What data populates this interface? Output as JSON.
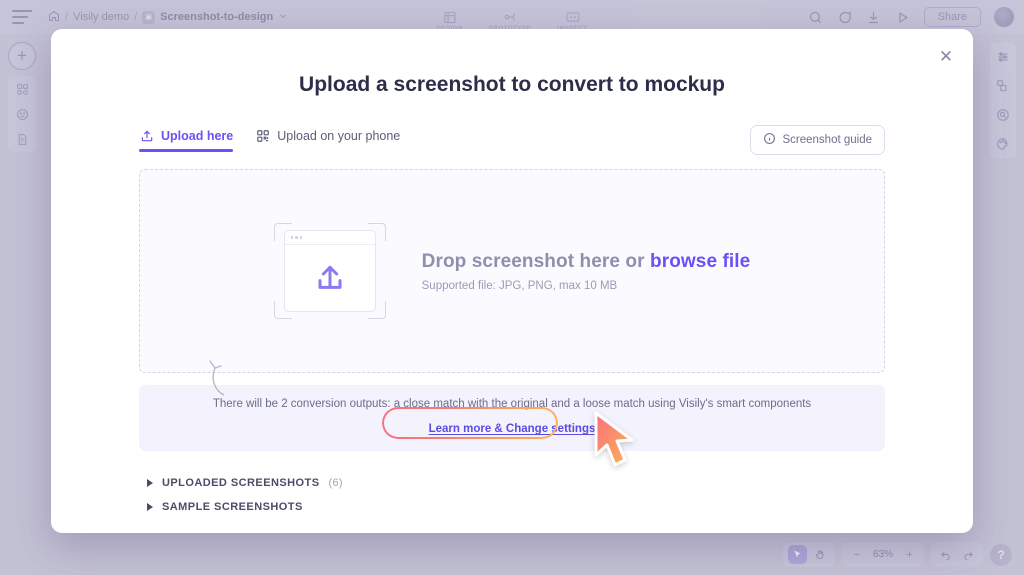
{
  "app": {
    "breadcrumb": {
      "home_icon": "home-icon",
      "project": "Visily demo",
      "file_icon": "file-thumbnail-icon",
      "file": "Screenshot-to-design",
      "chevron": "chevron-down-icon",
      "separator": "/"
    },
    "modes": [
      {
        "label": "DESIGN",
        "icon": "design-icon"
      },
      {
        "label": "PROTOTYPE",
        "icon": "prototype-icon"
      },
      {
        "label": "INSPECT",
        "icon": "inspect-icon"
      }
    ],
    "top_right": {
      "icons": [
        "search-icon",
        "comment-icon",
        "download-icon",
        "present-icon"
      ],
      "share_label": "Share",
      "avatar": "user-avatar"
    },
    "left_sidebar": {
      "add_label": "+",
      "items": [
        "components-icon",
        "emoji-icon",
        "template-icon"
      ]
    },
    "right_sidebar": {
      "items": [
        "adjustments-icon",
        "layers-icon",
        "inspect-zoom-icon",
        "palette-icon"
      ]
    },
    "bottom_bar": {
      "cursor_icon": "cursor-tool-icon",
      "hand_icon": "hand-tool-icon",
      "zoom_out": "−",
      "zoom_level": "63%",
      "zoom_in": "+",
      "undo": "undo-icon",
      "redo": "redo-icon",
      "help": "?"
    }
  },
  "modal": {
    "close_label": "✕",
    "title": "Upload a screenshot to convert to mockup",
    "tabs": [
      {
        "label": "Upload here",
        "icon": "upload-icon",
        "active": true
      },
      {
        "label": "Upload on your phone",
        "icon": "qr-code-icon",
        "active": false
      }
    ],
    "guide_button": {
      "label": "Screenshot guide",
      "icon": "info-icon"
    },
    "dropzone": {
      "headline_prefix": "Drop screenshot here or ",
      "headline_link": "browse file",
      "subtext": "Supported file: JPG, PNG, max 10 MB",
      "illustration": "upload-window-icon"
    },
    "info_banner": {
      "text": "There will be 2 conversion outputs: a close match with the original and a loose match using Visily's smart components",
      "link": "Learn more & Change settings"
    },
    "sections": [
      {
        "label": "UPLOADED SCREENSHOTS",
        "count": "(6)"
      },
      {
        "label": "SAMPLE SCREENSHOTS",
        "count": ""
      }
    ]
  },
  "colors": {
    "accent": "#6c4ff7",
    "canvas": "#c3c1d4",
    "banner_bg": "#f4f2fc",
    "cursor_gradient_start": "#f8707f",
    "cursor_gradient_end": "#fbb454"
  }
}
